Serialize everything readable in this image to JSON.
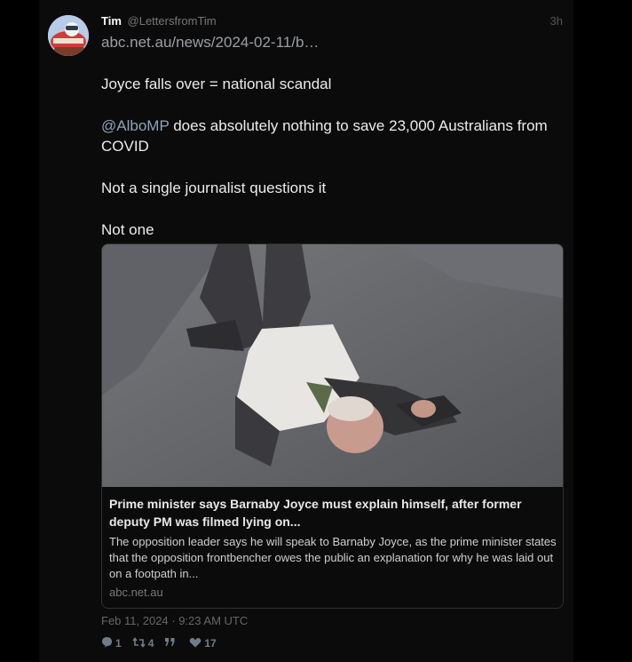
{
  "tweet": {
    "author_name": "Tim",
    "author_handle": "@LettersfromTim",
    "relative_time": "3h",
    "link": "abc.net.au/news/2024-02-11/b…",
    "paragraphs": [
      "Joyce falls over = national scandal",
      "does absolutely nothing to save 23,000 Australians from COVID",
      "Not a single journalist questions it",
      "Not one"
    ],
    "mention": "@AlboMP",
    "timestamp": "Feb 11, 2024 · 9:23 AM UTC"
  },
  "card": {
    "title": "Prime minister says Barnaby Joyce must explain himself, after former deputy PM was filmed lying on...",
    "description": "The opposition leader says he will speak to Barnaby Joyce, as the prime minister states that the opposition frontbencher owes the public an explanation for why he was laid out on a footpath in...",
    "domain": "abc.net.au"
  },
  "stats": {
    "replies": "1",
    "retweets": "4",
    "quotes": "",
    "likes": "17"
  },
  "icons": {
    "reply": "comment-icon",
    "retweet": "retweet-icon",
    "quote": "quote-icon",
    "like": "heart-icon"
  },
  "colors": {
    "background": "#000000",
    "tweet_background": "#0b0b0b",
    "link": "#9a9fa5",
    "mention": "#8fa3b8",
    "muted": "#666666",
    "stat": "#6e7d8c"
  }
}
